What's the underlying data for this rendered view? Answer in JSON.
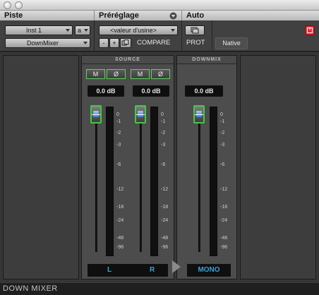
{
  "header": {
    "piste_label": "Piste",
    "preset_label": "Préréglage",
    "auto_label": "Auto",
    "track_name": "Inst 1",
    "track_channel": "a",
    "plugin_name": "DownMixer",
    "preset_value": "<valeur d'usine>",
    "minus_label": "-",
    "plus_label": "+",
    "compare_label": "COMPARE",
    "prot_label": "PROT",
    "native_label": "Native"
  },
  "source": {
    "title": "SOURCE",
    "channels": [
      {
        "mute": "M",
        "phase": "Ø",
        "gain": "0.0 dB",
        "label": "L"
      },
      {
        "mute": "M",
        "phase": "Ø",
        "gain": "0.0 dB",
        "label": "R"
      }
    ]
  },
  "downmix": {
    "title": "DOWNMIX",
    "gain": "0.0 dB",
    "label": "MONO"
  },
  "scale_ticks": [
    "0",
    "-1",
    "-2",
    "-3",
    "-6",
    "-12",
    "-18",
    "-24",
    "-48",
    "-96"
  ],
  "footer": {
    "title": "DOWN MIXER"
  },
  "colors": {
    "accent_green": "#45c845",
    "label_blue": "#39a3d8",
    "fader_blue": "#3f78cc",
    "bypass_red": "#d8252e"
  }
}
